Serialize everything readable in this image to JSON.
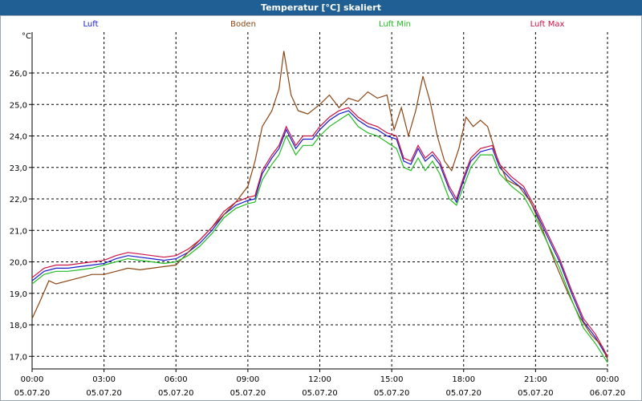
{
  "title": "Temperatur [°C] skaliert",
  "legend": [
    {
      "name": "Luft",
      "color": "#1a1acc"
    },
    {
      "name": "Boden",
      "color": "#8b4513"
    },
    {
      "name": "Luft Min",
      "color": "#22bb22"
    },
    {
      "name": "Luft Max",
      "color": "#cc1144"
    }
  ],
  "chart_data": {
    "type": "line",
    "ylabel": "°C",
    "ylim": [
      16.6,
      27.3
    ],
    "xlim": [
      0,
      24
    ],
    "y_ticks": [
      "17,0",
      "18,0",
      "19,0",
      "20,0",
      "21,0",
      "22,0",
      "23,0",
      "24,0",
      "25,0",
      "26,0"
    ],
    "x_ticks": [
      {
        "time": "00:00",
        "date": "05.07.20"
      },
      {
        "time": "03:00",
        "date": "05.07.20"
      },
      {
        "time": "06:00",
        "date": "05.07.20"
      },
      {
        "time": "09:00",
        "date": "05.07.20"
      },
      {
        "time": "12:00",
        "date": "05.07.20"
      },
      {
        "time": "15:00",
        "date": "05.07.20"
      },
      {
        "time": "18:00",
        "date": "05.07.20"
      },
      {
        "time": "21:00",
        "date": "05.07.20"
      },
      {
        "time": "00:00",
        "date": "06.07.20"
      }
    ],
    "grid": true,
    "legend_position": "top",
    "series": [
      {
        "name": "Luft",
        "color": "#1a1acc",
        "points": [
          [
            0,
            19.4
          ],
          [
            0.5,
            19.7
          ],
          [
            1,
            19.8
          ],
          [
            1.5,
            19.8
          ],
          [
            2,
            19.85
          ],
          [
            2.5,
            19.9
          ],
          [
            3,
            19.95
          ],
          [
            3.5,
            20.1
          ],
          [
            4,
            20.2
          ],
          [
            4.5,
            20.15
          ],
          [
            5,
            20.1
          ],
          [
            5.5,
            20.05
          ],
          [
            6,
            20.1
          ],
          [
            6.5,
            20.3
          ],
          [
            7,
            20.6
          ],
          [
            7.5,
            21.0
          ],
          [
            8,
            21.5
          ],
          [
            8.5,
            21.8
          ],
          [
            9,
            21.95
          ],
          [
            9.3,
            22.0
          ],
          [
            9.6,
            22.8
          ],
          [
            10,
            23.3
          ],
          [
            10.3,
            23.6
          ],
          [
            10.6,
            24.2
          ],
          [
            11,
            23.6
          ],
          [
            11.3,
            23.9
          ],
          [
            11.7,
            23.9
          ],
          [
            12,
            24.2
          ],
          [
            12.4,
            24.5
          ],
          [
            12.8,
            24.7
          ],
          [
            13.2,
            24.8
          ],
          [
            13.6,
            24.5
          ],
          [
            14,
            24.3
          ],
          [
            14.4,
            24.2
          ],
          [
            14.8,
            24.0
          ],
          [
            15.2,
            23.9
          ],
          [
            15.5,
            23.2
          ],
          [
            15.8,
            23.1
          ],
          [
            16.1,
            23.6
          ],
          [
            16.4,
            23.2
          ],
          [
            16.7,
            23.4
          ],
          [
            17,
            23.1
          ],
          [
            17.4,
            22.3
          ],
          [
            17.7,
            21.9
          ],
          [
            18,
            22.6
          ],
          [
            18.3,
            23.2
          ],
          [
            18.7,
            23.5
          ],
          [
            19.2,
            23.6
          ],
          [
            19.5,
            23.0
          ],
          [
            20,
            22.6
          ],
          [
            20.5,
            22.3
          ],
          [
            21,
            21.6
          ],
          [
            21.5,
            20.8
          ],
          [
            22,
            20.0
          ],
          [
            22.5,
            19.0
          ],
          [
            23,
            18.1
          ],
          [
            23.5,
            17.6
          ],
          [
            24,
            16.95
          ]
        ]
      },
      {
        "name": "Boden",
        "color": "#8b4513",
        "points": [
          [
            0,
            18.2
          ],
          [
            0.3,
            18.7
          ],
          [
            0.7,
            19.4
          ],
          [
            1,
            19.3
          ],
          [
            1.5,
            19.4
          ],
          [
            2,
            19.5
          ],
          [
            2.5,
            19.6
          ],
          [
            3,
            19.6
          ],
          [
            3.5,
            19.7
          ],
          [
            4,
            19.8
          ],
          [
            4.5,
            19.75
          ],
          [
            5,
            19.8
          ],
          [
            5.5,
            19.85
          ],
          [
            6,
            19.9
          ],
          [
            6.5,
            20.3
          ],
          [
            7,
            20.7
          ],
          [
            7.5,
            21.1
          ],
          [
            8,
            21.5
          ],
          [
            8.5,
            21.9
          ],
          [
            9,
            22.4
          ],
          [
            9.3,
            23.2
          ],
          [
            9.6,
            24.3
          ],
          [
            10,
            24.8
          ],
          [
            10.3,
            25.5
          ],
          [
            10.5,
            26.7
          ],
          [
            10.8,
            25.3
          ],
          [
            11.1,
            24.8
          ],
          [
            11.5,
            24.7
          ],
          [
            12,
            25.0
          ],
          [
            12.4,
            25.3
          ],
          [
            12.8,
            24.9
          ],
          [
            13.2,
            25.2
          ],
          [
            13.6,
            25.1
          ],
          [
            14,
            25.4
          ],
          [
            14.4,
            25.2
          ],
          [
            14.8,
            25.3
          ],
          [
            15.1,
            24.2
          ],
          [
            15.4,
            24.9
          ],
          [
            15.7,
            24.0
          ],
          [
            16,
            24.8
          ],
          [
            16.3,
            25.9
          ],
          [
            16.6,
            25.1
          ],
          [
            16.9,
            24.0
          ],
          [
            17.2,
            23.2
          ],
          [
            17.5,
            22.9
          ],
          [
            17.8,
            23.6
          ],
          [
            18.1,
            24.6
          ],
          [
            18.4,
            24.3
          ],
          [
            18.7,
            24.5
          ],
          [
            19,
            24.3
          ],
          [
            19.4,
            23.3
          ],
          [
            19.8,
            22.6
          ],
          [
            20.3,
            22.4
          ],
          [
            20.8,
            21.9
          ],
          [
            21.3,
            21.0
          ],
          [
            21.8,
            20.0
          ],
          [
            22.3,
            19.1
          ],
          [
            22.8,
            18.3
          ],
          [
            23.3,
            17.7
          ],
          [
            23.8,
            17.3
          ],
          [
            24,
            16.9
          ]
        ]
      },
      {
        "name": "Luft Min",
        "color": "#22bb22",
        "points": [
          [
            0,
            19.3
          ],
          [
            0.5,
            19.6
          ],
          [
            1,
            19.7
          ],
          [
            1.5,
            19.7
          ],
          [
            2,
            19.75
          ],
          [
            2.5,
            19.8
          ],
          [
            3,
            19.9
          ],
          [
            3.5,
            20.0
          ],
          [
            4,
            20.1
          ],
          [
            4.5,
            20.05
          ],
          [
            5,
            20.0
          ],
          [
            5.5,
            19.95
          ],
          [
            6,
            20.0
          ],
          [
            6.5,
            20.2
          ],
          [
            7,
            20.5
          ],
          [
            7.5,
            20.9
          ],
          [
            8,
            21.4
          ],
          [
            8.5,
            21.7
          ],
          [
            9,
            21.85
          ],
          [
            9.3,
            21.9
          ],
          [
            9.6,
            22.6
          ],
          [
            10,
            23.1
          ],
          [
            10.3,
            23.4
          ],
          [
            10.6,
            24.0
          ],
          [
            11,
            23.4
          ],
          [
            11.3,
            23.7
          ],
          [
            11.7,
            23.7
          ],
          [
            12,
            24.0
          ],
          [
            12.4,
            24.3
          ],
          [
            12.8,
            24.5
          ],
          [
            13.2,
            24.7
          ],
          [
            13.6,
            24.3
          ],
          [
            14,
            24.1
          ],
          [
            14.4,
            24.0
          ],
          [
            14.8,
            23.8
          ],
          [
            15.2,
            23.6
          ],
          [
            15.5,
            23.0
          ],
          [
            15.8,
            22.9
          ],
          [
            16.1,
            23.3
          ],
          [
            16.4,
            22.9
          ],
          [
            16.7,
            23.2
          ],
          [
            17,
            22.8
          ],
          [
            17.4,
            22.0
          ],
          [
            17.7,
            21.8
          ],
          [
            18,
            22.4
          ],
          [
            18.3,
            23.0
          ],
          [
            18.7,
            23.4
          ],
          [
            19.2,
            23.4
          ],
          [
            19.5,
            22.8
          ],
          [
            20,
            22.4
          ],
          [
            20.5,
            22.1
          ],
          [
            21,
            21.4
          ],
          [
            21.5,
            20.6
          ],
          [
            22,
            19.8
          ],
          [
            22.5,
            18.8
          ],
          [
            23,
            17.9
          ],
          [
            23.5,
            17.4
          ],
          [
            24,
            16.8
          ]
        ]
      },
      {
        "name": "Luft Max",
        "color": "#cc1144",
        "points": [
          [
            0,
            19.5
          ],
          [
            0.5,
            19.8
          ],
          [
            1,
            19.9
          ],
          [
            1.5,
            19.9
          ],
          [
            2,
            19.95
          ],
          [
            2.5,
            20.0
          ],
          [
            3,
            20.05
          ],
          [
            3.5,
            20.2
          ],
          [
            4,
            20.3
          ],
          [
            4.5,
            20.25
          ],
          [
            5,
            20.2
          ],
          [
            5.5,
            20.15
          ],
          [
            6,
            20.2
          ],
          [
            6.5,
            20.4
          ],
          [
            7,
            20.7
          ],
          [
            7.5,
            21.1
          ],
          [
            8,
            21.6
          ],
          [
            8.5,
            21.9
          ],
          [
            9,
            22.05
          ],
          [
            9.3,
            22.1
          ],
          [
            9.6,
            22.9
          ],
          [
            10,
            23.4
          ],
          [
            10.3,
            23.7
          ],
          [
            10.6,
            24.3
          ],
          [
            11,
            23.7
          ],
          [
            11.3,
            24.0
          ],
          [
            11.7,
            24.0
          ],
          [
            12,
            24.3
          ],
          [
            12.4,
            24.6
          ],
          [
            12.8,
            24.8
          ],
          [
            13.2,
            24.9
          ],
          [
            13.6,
            24.6
          ],
          [
            14,
            24.4
          ],
          [
            14.4,
            24.3
          ],
          [
            14.8,
            24.1
          ],
          [
            15.2,
            24.0
          ],
          [
            15.5,
            23.3
          ],
          [
            15.8,
            23.2
          ],
          [
            16.1,
            23.7
          ],
          [
            16.4,
            23.3
          ],
          [
            16.7,
            23.5
          ],
          [
            17,
            23.2
          ],
          [
            17.4,
            22.4
          ],
          [
            17.7,
            22.0
          ],
          [
            18,
            22.7
          ],
          [
            18.3,
            23.3
          ],
          [
            18.7,
            23.6
          ],
          [
            19.2,
            23.7
          ],
          [
            19.5,
            23.1
          ],
          [
            20,
            22.7
          ],
          [
            20.5,
            22.4
          ],
          [
            21,
            21.7
          ],
          [
            21.5,
            20.9
          ],
          [
            22,
            20.1
          ],
          [
            22.5,
            19.1
          ],
          [
            23,
            18.2
          ],
          [
            23.5,
            17.7
          ],
          [
            24,
            17.0
          ]
        ]
      }
    ]
  }
}
